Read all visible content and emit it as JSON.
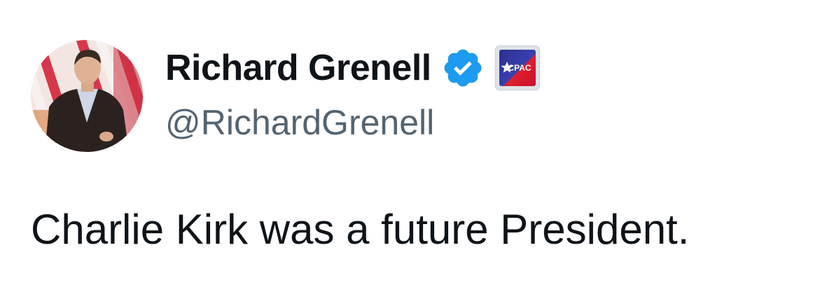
{
  "author": {
    "display_name": "Richard Grenell",
    "handle": "@RichardGrenell",
    "verified_icon": "verified-badge-icon",
    "affiliate_badge": {
      "icon": "cpac-logo-icon",
      "label": "CPAC"
    }
  },
  "tweet": {
    "text": "Charlie Kirk was a future President."
  },
  "colors": {
    "text_primary": "#0f1419",
    "text_secondary": "#536471",
    "verified_blue": "#1d9bf0",
    "background": "#ffffff"
  }
}
